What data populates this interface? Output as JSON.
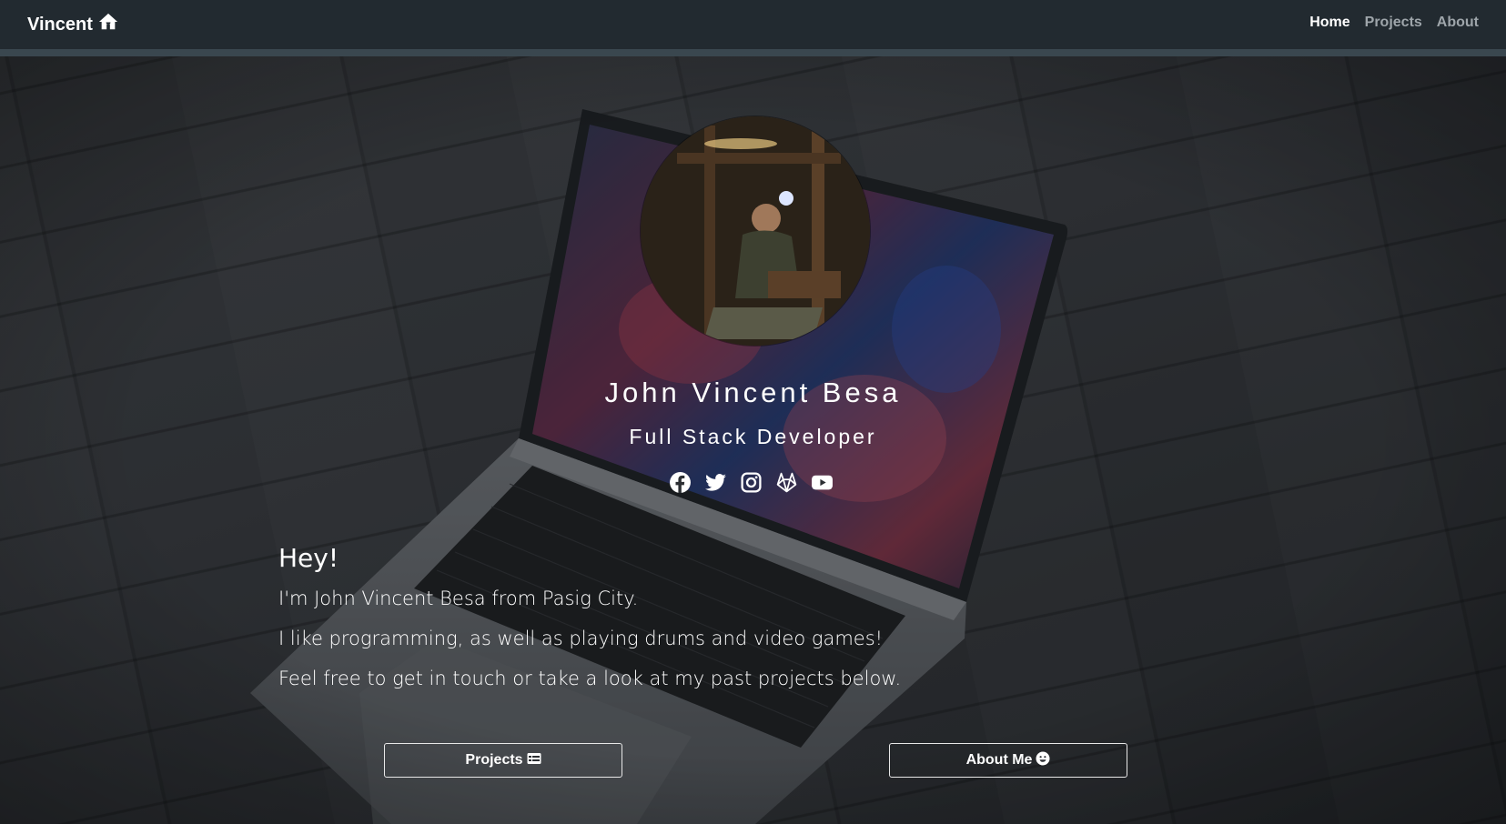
{
  "navbar": {
    "brand": "Vincent",
    "brand_icon": "home-icon",
    "links": [
      {
        "label": "Home",
        "active": true
      },
      {
        "label": "Projects",
        "active": false
      },
      {
        "label": "About",
        "active": false
      }
    ]
  },
  "hero": {
    "name": "John Vincent Besa",
    "role": "Full Stack Developer",
    "socials": [
      "facebook-icon",
      "twitter-icon",
      "instagram-icon",
      "gitlab-icon",
      "youtube-icon"
    ],
    "greeting": "Hey!",
    "lines": [
      "I'm John Vincent Besa from Pasig City.",
      "I like programming, as well as playing drums and video games!",
      "Feel free to get in touch or take a look at my past projects below."
    ]
  },
  "buttons": {
    "projects_label": "Projects",
    "projects_icon": "card-list-icon",
    "about_label": "About Me",
    "about_icon": "smiley-icon"
  },
  "colors": {
    "navbar_bg": "#222a30",
    "navbar_border": "#3a474f",
    "nav_inactive": "#9ea5aa",
    "nav_active": "#ffffff"
  }
}
